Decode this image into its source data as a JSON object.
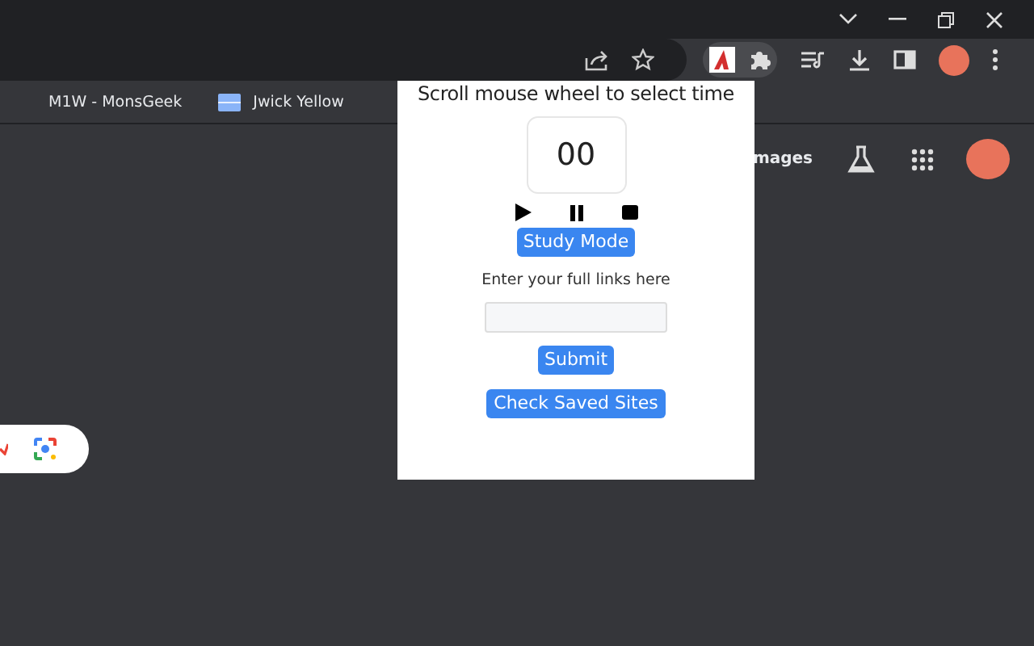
{
  "bookmarks": [
    {
      "label": "M1W - MonsGeek",
      "kind": "plain"
    },
    {
      "label": "Jwick Yellow",
      "kind": "favicon"
    }
  ],
  "page": {
    "images_link": "mages"
  },
  "popup": {
    "instruction": "Scroll mouse wheel to select time",
    "timer": "00",
    "study_button": "Study Mode",
    "links_label": "Enter your full links here",
    "submit_button": "Submit",
    "saved_button": "Check Saved Sites"
  }
}
